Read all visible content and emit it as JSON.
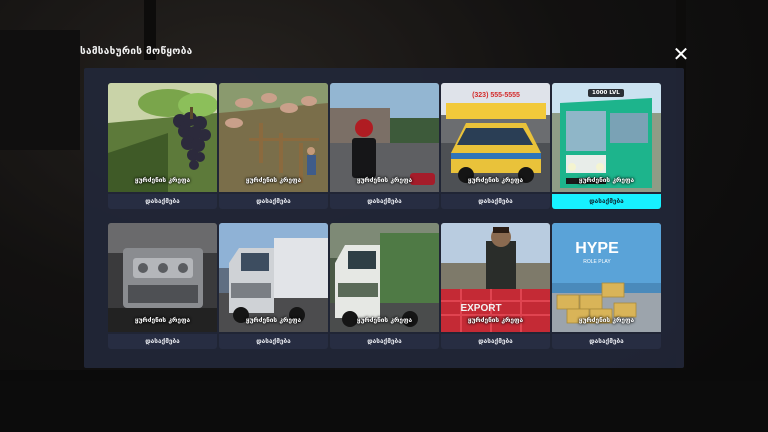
{
  "modal": {
    "title": "სამსახურის მოწყობა",
    "close_icon": "close-icon",
    "accent_color": "#17f1ff",
    "panel_color": "#222738"
  },
  "jobs": [
    {
      "id": "vineyard",
      "thumb_label": "ყურძენის კრეფა",
      "button": "დასაქმება",
      "selected": false,
      "scene": "grapes"
    },
    {
      "id": "farm",
      "thumb_label": "ყურძენის კრეფა",
      "button": "დასაქმება",
      "selected": false,
      "scene": "farm"
    },
    {
      "id": "street",
      "thumb_label": "ყურძენის კრეფა",
      "button": "დასაქმება",
      "selected": false,
      "scene": "street"
    },
    {
      "id": "taxi",
      "thumb_label": "ყურძენის კრეფა",
      "button": "დასაქმება",
      "selected": false,
      "scene": "taxi"
    },
    {
      "id": "bus",
      "thumb_label": "ყურძენის კრეფა",
      "button": "დასაქმება",
      "selected": true,
      "scene": "bus",
      "badge": "1000 LVL"
    },
    {
      "id": "mechanic",
      "thumb_label": "ყურძენის კრეფა",
      "button": "დასაქმება",
      "selected": false,
      "scene": "engine"
    },
    {
      "id": "trucker",
      "thumb_label": "ყურძენის კრეფა",
      "button": "დასაქმება",
      "selected": false,
      "scene": "truck_white"
    },
    {
      "id": "garbage",
      "thumb_label": "ყურძენის კრეფა",
      "button": "დასაქმება",
      "selected": false,
      "scene": "truck_green"
    },
    {
      "id": "export",
      "thumb_label": "ყურძენის კრეფა",
      "button": "დასაქმება",
      "selected": false,
      "scene": "export"
    },
    {
      "id": "delivery",
      "thumb_label": "ყურძენის კრეფა",
      "button": "დასაქმება",
      "selected": false,
      "scene": "hype_van"
    }
  ],
  "scene_text": {
    "taxi_sign": "(323) 555-5555",
    "export_sign": "EXPORT",
    "hype_logo": "HYPE",
    "hype_sub": "ROLE PLAY"
  }
}
